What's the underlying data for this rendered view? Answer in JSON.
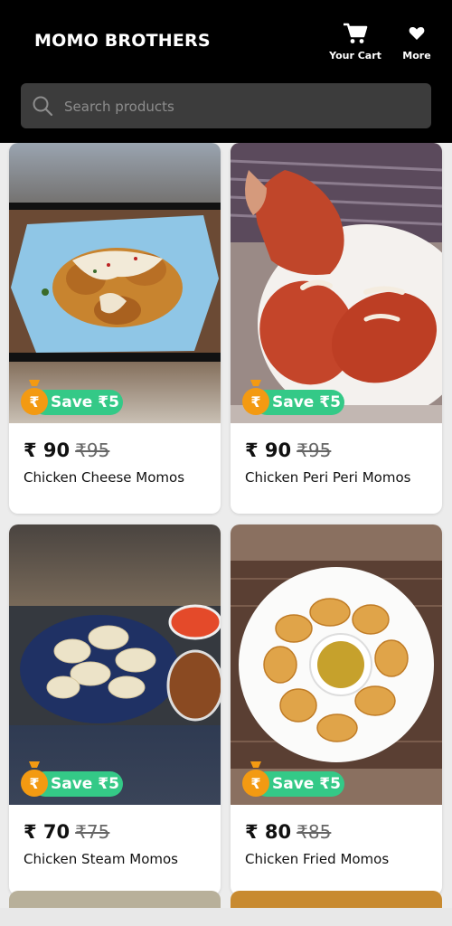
{
  "header": {
    "brand": "MOMO BROTHERS",
    "cart_label": "Your Cart",
    "more_label": "More",
    "search_placeholder": "Search products"
  },
  "products": [
    {
      "price": "₹ 90",
      "old_price": "₹95",
      "name": "Chicken Cheese Momos",
      "save": "Save ₹5",
      "image_desc": "fried momos with cheese sauce on blue plate"
    },
    {
      "price": "₹ 90",
      "old_price": "₹95",
      "name": "Chicken Peri Peri Momos",
      "save": "Save ₹5",
      "image_desc": "red peri peri momos on white plate"
    },
    {
      "price": "₹ 70",
      "old_price": "₹75",
      "name": "Chicken Steam Momos",
      "save": "Save ₹5",
      "image_desc": "steamed momos on dark blue plate with chutney"
    },
    {
      "price": "₹ 80",
      "old_price": "₹85",
      "name": "Chicken Fried Momos",
      "save": "Save ₹5",
      "image_desc": "fried momos around bowl of sauce"
    }
  ],
  "colors": {
    "header_bg": "#000000",
    "search_bg": "#3c3c3c",
    "save_badge": "#34c987",
    "bag_orange": "#f39a12"
  }
}
